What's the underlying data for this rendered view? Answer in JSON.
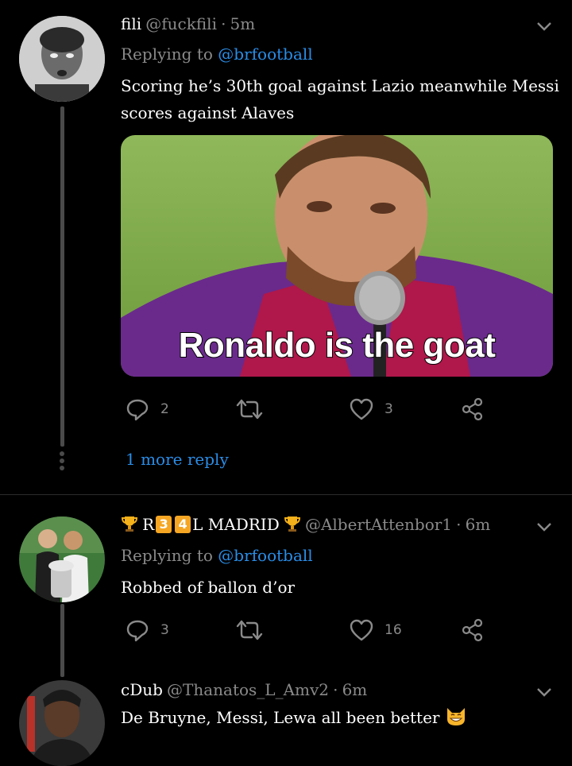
{
  "tweets": [
    {
      "display_name": "fili",
      "handle": "@fuckfili",
      "time": "5m",
      "replying_prefix": "Replying to",
      "replying_handle": "@brfootball",
      "text_line1": "Scoring he’s 30th goal against Lazio meanwhile Messi",
      "text_line2": "scores against Alaves",
      "media_caption": "Ronaldo is the goat",
      "replies": "2",
      "retweets": "",
      "likes": "3",
      "more_reply": "1 more reply"
    },
    {
      "display_name_prefix": "R",
      "badge1": "3",
      "badge2": "4",
      "display_name_suffix": "L MADRID",
      "handle": "@AlbertAttenbor1",
      "time": "6m",
      "replying_prefix": "Replying to",
      "replying_handle": "@brfootball",
      "text": "Robbed of ballon d’or",
      "replies": "3",
      "retweets": "",
      "likes": "16"
    },
    {
      "display_name": "cDub",
      "handle": "@Thanatos_L_Amv2",
      "time": "6m",
      "text": "De Bruyne, Messi, Lewa all been better"
    }
  ],
  "separator": "·",
  "icons": [
    "reply-icon",
    "retweet-icon",
    "like-icon",
    "share-icon",
    "chevron-down-icon",
    "trophy-icon",
    "grinning-cat-emoji"
  ],
  "colors": {
    "link": "#2a8ee8",
    "muted": "#8a8a8a",
    "background": "#000000",
    "badge": "#f5a623"
  }
}
